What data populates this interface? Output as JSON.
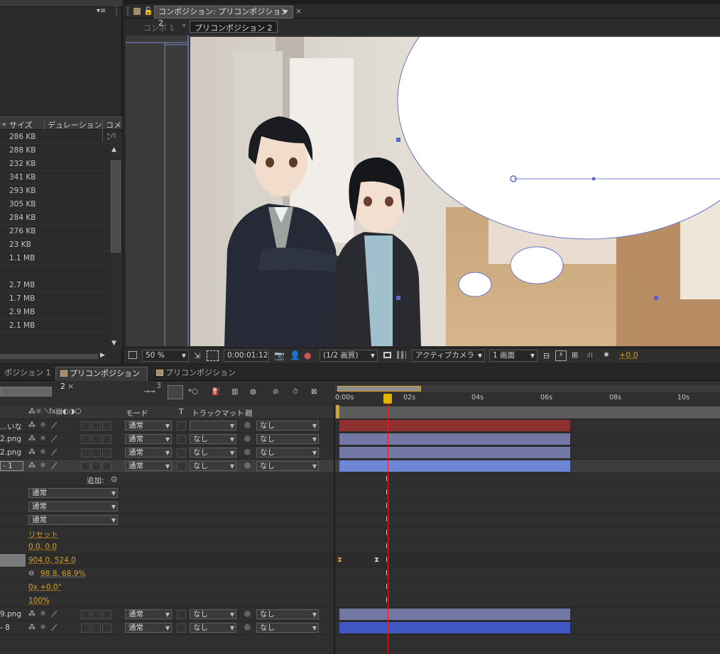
{
  "project_panel": {
    "menu_glyph": "▾≡",
    "columns": [
      "サイズ",
      "デュレーション",
      "コメン"
    ],
    "sizes": [
      "286 KB",
      "288 KB",
      "232 KB",
      "341 KB",
      "293 KB",
      "305 KB",
      "284 KB",
      "276 KB",
      "23 KB",
      "1.1 MB",
      "",
      "2.7 MB",
      "1.7 MB",
      "2.9 MB",
      "2.1 MB",
      "",
      ""
    ]
  },
  "composition_panel": {
    "tab_title": "コンポジション: プリコンポジション 2",
    "breadcrumb_parent": "コンポ 1",
    "breadcrumb_current": "プリコンポジション 2",
    "zoom": "50 %",
    "timecode": "0:00:01:12",
    "resolution": "(1/2 画質)",
    "camera": "アクティブカメラ",
    "view_layout": "1 画面",
    "exposure": "+0.0"
  },
  "timeline": {
    "tabs": [
      "ポジション 1",
      "プリコンポジション 2",
      "プリコンポジション 3"
    ],
    "active_tab": 1,
    "ruler": [
      "0:00s",
      "02s",
      "04s",
      "06s",
      "08s",
      "10s"
    ],
    "col_headers": {
      "mode": "モード",
      "t": "T",
      "trackmatte": "トラックマット",
      "parent": "親"
    },
    "layers": [
      {
        "name": "...いな",
        "mode": "通常",
        "trackmatte": "",
        "parent": "なし",
        "bar_color": "#8e3030"
      },
      {
        "name": "2.png",
        "mode": "通常",
        "trackmatte": "なし",
        "parent": "なし",
        "bar_color": "#7377a4"
      },
      {
        "name": "2.png",
        "mode": "通常",
        "trackmatte": "なし",
        "parent": "なし",
        "bar_color": "#7377a4"
      },
      {
        "name": "- 1",
        "mode": "通常",
        "trackmatte": "なし",
        "parent": "なし",
        "bar_color": "#6e86d6"
      }
    ],
    "add_label": "追加:",
    "mode_props": [
      "通常",
      "通常",
      "通常"
    ],
    "reset_label": "リセット",
    "anchor": "0.0, 0.0",
    "position": "904.0, 524.0",
    "scale": "98.8, 68.9%",
    "rotation": "0x +0.0°",
    "opacity": "100%",
    "bottom_layers": [
      {
        "name": "9.png",
        "mode": "通常",
        "trackmatte": "なし",
        "parent": "なし",
        "bar_color": "#7377a4"
      },
      {
        "name": "- 8",
        "mode": "通常",
        "trackmatte": "なし",
        "parent": "なし",
        "bar_color": "#3f57c2"
      }
    ]
  }
}
